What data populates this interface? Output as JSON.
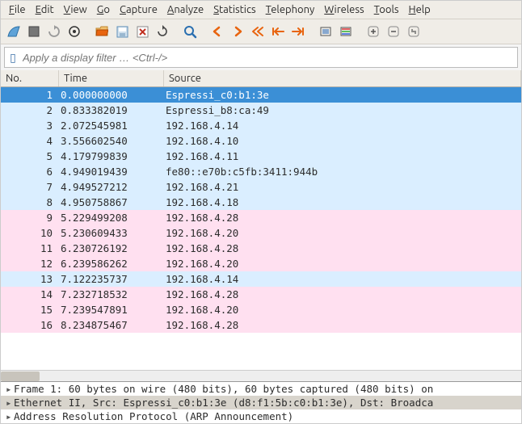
{
  "menu": [
    "File",
    "Edit",
    "View",
    "Go",
    "Capture",
    "Analyze",
    "Statistics",
    "Telephony",
    "Wireless",
    "Tools",
    "Help"
  ],
  "filter": {
    "placeholder": "Apply a display filter … <Ctrl-/>"
  },
  "columns": {
    "no": "No.",
    "time": "Time",
    "source": "Source"
  },
  "packets": [
    {
      "no": 1,
      "time": "0.000000000",
      "source": "Espressi_c0:b1:3e",
      "cls": "row-selected"
    },
    {
      "no": 2,
      "time": "0.833382019",
      "source": "Espressi_b8:ca:49",
      "cls": "row-blue"
    },
    {
      "no": 3,
      "time": "2.072545981",
      "source": "192.168.4.14",
      "cls": "row-blue"
    },
    {
      "no": 4,
      "time": "3.556602540",
      "source": "192.168.4.10",
      "cls": "row-blue"
    },
    {
      "no": 5,
      "time": "4.179799839",
      "source": "192.168.4.11",
      "cls": "row-blue"
    },
    {
      "no": 6,
      "time": "4.949019439",
      "source": "fe80::e70b:c5fb:3411:944b",
      "cls": "row-blue"
    },
    {
      "no": 7,
      "time": "4.949527212",
      "source": "192.168.4.21",
      "cls": "row-blue"
    },
    {
      "no": 8,
      "time": "4.950758867",
      "source": "192.168.4.18",
      "cls": "row-blue"
    },
    {
      "no": 9,
      "time": "5.229499208",
      "source": "192.168.4.28",
      "cls": "row-pink"
    },
    {
      "no": 10,
      "time": "5.230609433",
      "source": "192.168.4.20",
      "cls": "row-pink"
    },
    {
      "no": 11,
      "time": "6.230726192",
      "source": "192.168.4.28",
      "cls": "row-pink"
    },
    {
      "no": 12,
      "time": "6.239586262",
      "source": "192.168.4.20",
      "cls": "row-pink"
    },
    {
      "no": 13,
      "time": "7.122235737",
      "source": "192.168.4.14",
      "cls": "row-blue"
    },
    {
      "no": 14,
      "time": "7.232718532",
      "source": "192.168.4.28",
      "cls": "row-pink"
    },
    {
      "no": 15,
      "time": "7.239547891",
      "source": "192.168.4.20",
      "cls": "row-pink"
    },
    {
      "no": 16,
      "time": "8.234875467",
      "source": "192.168.4.28",
      "cls": "row-pink"
    }
  ],
  "details": [
    {
      "text": "Frame 1: 60 bytes on wire (480 bits), 60 bytes captured (480 bits) on",
      "sel": false
    },
    {
      "text": "Ethernet II, Src: Espressi_c0:b1:3e (d8:f1:5b:c0:b1:3e), Dst: Broadca",
      "sel": true
    },
    {
      "text": "Address Resolution Protocol (ARP Announcement)",
      "sel": false
    }
  ],
  "colors": {
    "accent": "#e8640f"
  }
}
